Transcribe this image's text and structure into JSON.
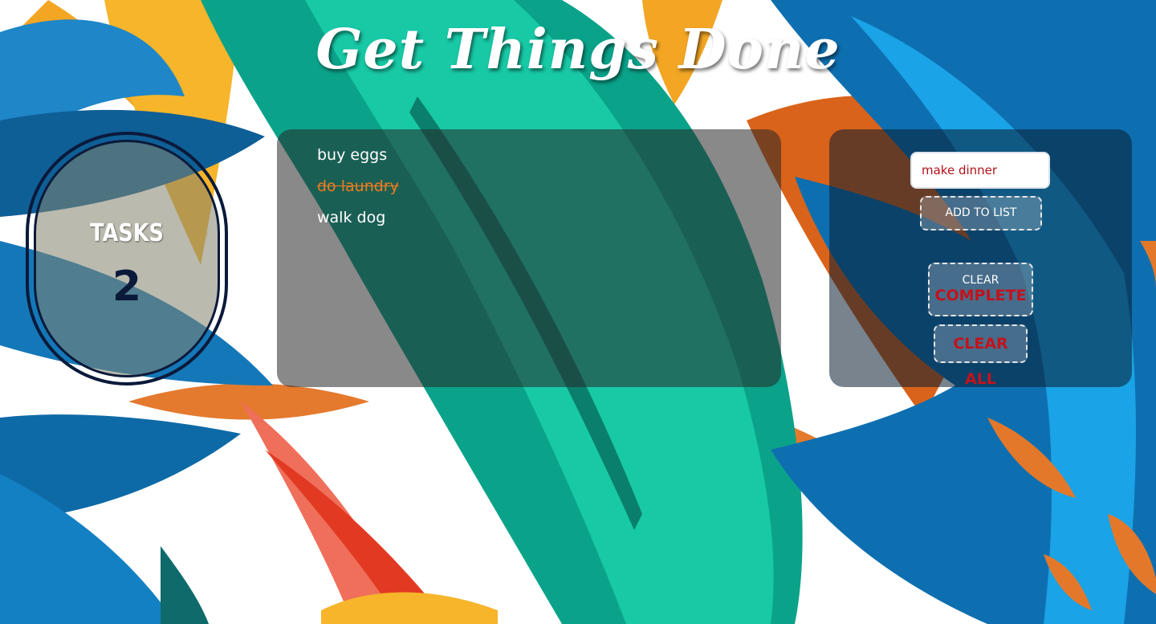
{
  "app": {
    "title": "Get Things Done"
  },
  "counter": {
    "label": "TASKS",
    "value": "2"
  },
  "tasks": [
    {
      "text": "buy eggs",
      "done": false
    },
    {
      "text": "do laundry",
      "done": true
    },
    {
      "text": "walk dog",
      "done": false
    }
  ],
  "form": {
    "input_value": "make dinner",
    "add_label": "ADD TO LIST"
  },
  "actions": {
    "clear_complete_top": "CLEAR",
    "clear_complete_bottom": "COMPLETE",
    "clear_all": "CLEAR ALL"
  },
  "colors": {
    "accent_red": "#c4121c",
    "done_orange": "#f07c1e",
    "counter_navy": "#0b1a3a"
  }
}
